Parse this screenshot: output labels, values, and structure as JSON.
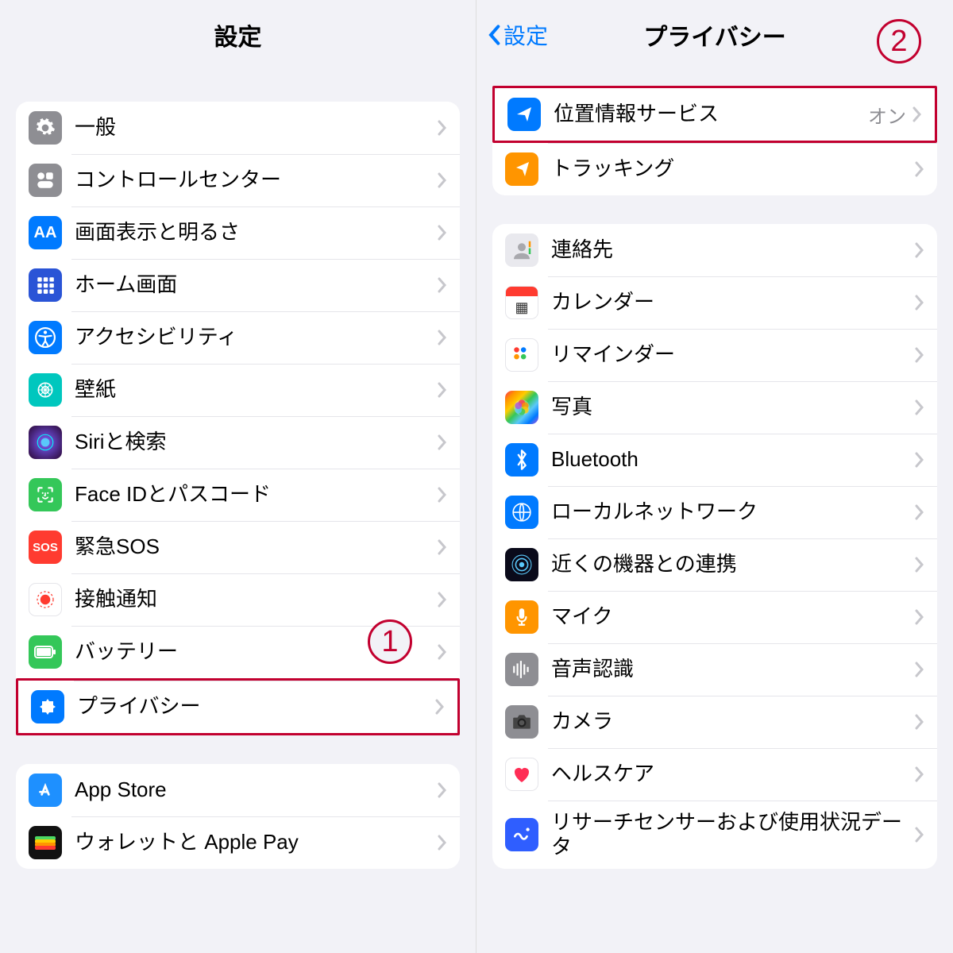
{
  "left": {
    "title": "設定",
    "callout": "1",
    "groups": [
      [
        {
          "icon": "gear-icon",
          "bg": "ic-gray",
          "label": "一般"
        },
        {
          "icon": "control-center-icon",
          "bg": "ic-gray",
          "label": "コントロールセンター"
        },
        {
          "icon": "display-icon",
          "bg": "ic-blue",
          "label": "画面表示と明るさ"
        },
        {
          "icon": "home-screen-icon",
          "bg": "ic-hgrid",
          "label": "ホーム画面"
        },
        {
          "icon": "accessibility-icon",
          "bg": "ic-blue",
          "label": "アクセシビリティ"
        },
        {
          "icon": "wallpaper-icon",
          "bg": "ic-teal",
          "label": "壁紙"
        },
        {
          "icon": "siri-icon",
          "bg": "ic-siri",
          "label": "Siriと検索"
        },
        {
          "icon": "faceid-icon",
          "bg": "ic-green",
          "label": "Face IDとパスコード"
        },
        {
          "icon": "sos-icon",
          "bg": "ic-red",
          "label": "緊急SOS"
        },
        {
          "icon": "exposure-icon",
          "bg": "ic-exposure",
          "label": "接触通知"
        },
        {
          "icon": "battery-icon",
          "bg": "ic-green",
          "label": "バッテリー"
        },
        {
          "icon": "privacy-icon",
          "bg": "ic-blue",
          "label": "プライバシー",
          "hl": true
        }
      ],
      [
        {
          "icon": "appstore-icon",
          "bg": "ic-appstore",
          "label": "App Store"
        },
        {
          "icon": "wallet-icon",
          "bg": "ic-wallet",
          "label": "ウォレットと Apple Pay"
        }
      ]
    ]
  },
  "right": {
    "back": "設定",
    "title": "プライバシー",
    "callout": "2",
    "groups": [
      [
        {
          "icon": "location-icon",
          "bg": "ic-blue",
          "label": "位置情報サービス",
          "value": "オン",
          "hl": true
        },
        {
          "icon": "tracking-icon",
          "bg": "ic-orange",
          "label": "トラッキング"
        }
      ],
      [
        {
          "icon": "contacts-icon",
          "bg": "ic-ct",
          "label": "連絡先"
        },
        {
          "icon": "calendar-icon",
          "bg": "ic-cal",
          "label": "カレンダー"
        },
        {
          "icon": "reminders-icon",
          "bg": "ic-rem",
          "label": "リマインダー"
        },
        {
          "icon": "photos-icon",
          "bg": "ic-photo",
          "label": "写真"
        },
        {
          "icon": "bluetooth-icon",
          "bg": "ic-blue",
          "label": "Bluetooth"
        },
        {
          "icon": "local-network-icon",
          "bg": "ic-network",
          "label": "ローカルネットワーク"
        },
        {
          "icon": "nearby-icon",
          "bg": "ic-nearby",
          "label": "近くの機器との連携"
        },
        {
          "icon": "microphone-icon",
          "bg": "ic-orange",
          "label": "マイク"
        },
        {
          "icon": "speech-icon",
          "bg": "ic-speech",
          "label": "音声認識"
        },
        {
          "icon": "camera-icon",
          "bg": "ic-camera",
          "label": "カメラ"
        },
        {
          "icon": "health-icon",
          "bg": "ic-white",
          "label": "ヘルスケア"
        },
        {
          "icon": "research-icon",
          "bg": "ic-research",
          "label": "リサーチセンサーおよび使用状況データ"
        }
      ]
    ]
  }
}
